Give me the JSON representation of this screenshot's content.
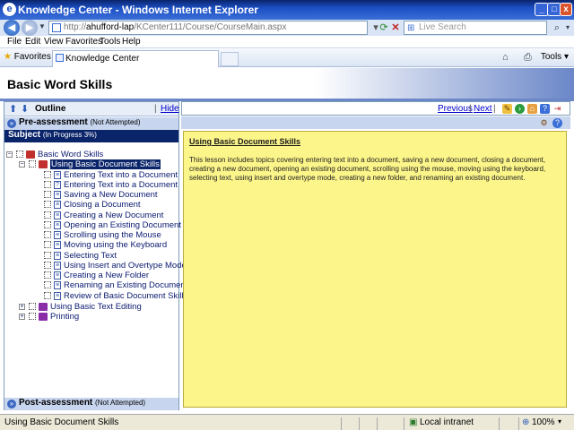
{
  "window": {
    "title": "Knowledge Center - Windows Internet Explorer",
    "minimize": "_",
    "maximize": "□",
    "close": "x"
  },
  "address": {
    "url_prefix": "http://",
    "url_host": "ahufford-lap",
    "url_path": "/KCenter111/Course/CourseMain.aspx",
    "search_placeholder": "Live Search"
  },
  "menu": [
    "File",
    "Edit",
    "View",
    "Favorites",
    "Tools",
    "Help"
  ],
  "tabs": {
    "favorites_label": "Favorites",
    "active_tab": "Knowledge Center",
    "tools_label": "Tools"
  },
  "page": {
    "title": "Basic Word Skills"
  },
  "outline": {
    "label": "Outline",
    "hide_link": "Hide",
    "separator": "|",
    "preassessment_label": "Pre-assessment",
    "preassessment_status": "(Not Attempted)",
    "subject_label": "Subject",
    "subject_status": "(In Progress 3%)",
    "postassessment_label": "Post-assessment",
    "postassessment_status": "(Not Attempted)"
  },
  "tree": {
    "root": "Basic Word Skills",
    "lesson": "Using Basic Document Skills",
    "topics": [
      "Entering Text into a Document",
      "Entering Text into a Document",
      "Saving a New Document",
      "Closing a Document",
      "Creating a New Document",
      "Opening an Existing Document",
      "Scrolling using the Mouse",
      "Moving using the Keyboard",
      "Selecting Text",
      "Using Insert and Overtype Mode",
      "Creating a New Folder",
      "Renaming an Existing Document",
      "Review of Basic Document Skills"
    ],
    "other_lessons": [
      "Using Basic Text Editing",
      "Printing"
    ]
  },
  "nav": {
    "previous": "Previous",
    "next": "Next",
    "sep": "|"
  },
  "content": {
    "title": "Using Basic Document Skills",
    "body": "This lesson includes topics covering entering text into a document, saving a new document, closing a document, creating a new document, opening an existing document, scrolling using the mouse, moving using the keyboard, selecting text, using insert and overtype mode, creating a new folder, and renaming an existing document."
  },
  "status": {
    "text": "Using Basic Document Skills",
    "zone": "Local intranet",
    "zoom": "100%"
  },
  "colors": {
    "selection": "#0a246a",
    "content_bg": "#fcf58a",
    "header_band": "#c7d5ee"
  }
}
